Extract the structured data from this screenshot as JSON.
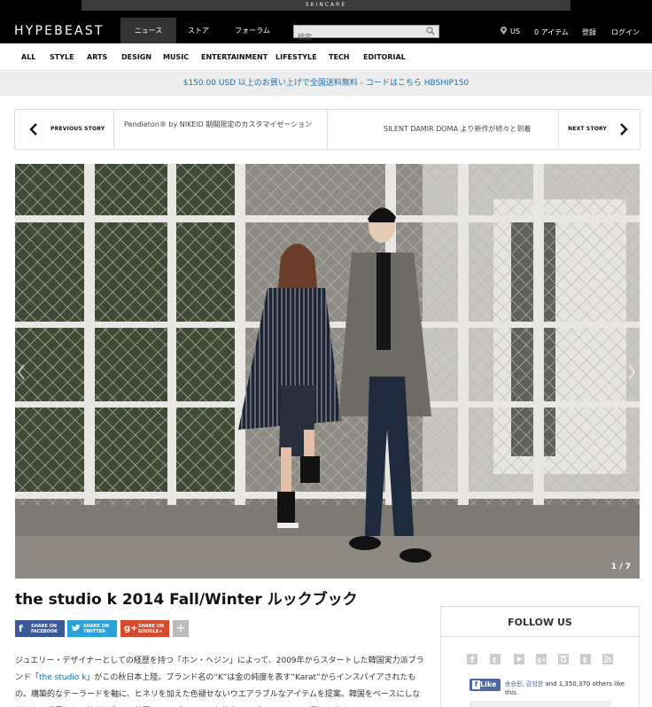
{
  "ad": {
    "text": "SKINCARE"
  },
  "header": {
    "logo": "HYPEBEAST",
    "tabs": [
      "ニュース",
      "ストア",
      "フォーラム"
    ],
    "search_placeholder": "検索",
    "region": "US",
    "cart": "0 アイテム",
    "register": "登録",
    "login": "ログイン"
  },
  "categories": [
    "ALL",
    "STYLE",
    "ARTS",
    "DESIGN",
    "MUSIC",
    "ENTERTAINMENT",
    "LIFESTYLE",
    "TECH",
    "EDITORIAL"
  ],
  "promo": "$150.00 USD 以上のお買い上げで全国送料無料 - コードはこちら HBSHIP150",
  "story_nav": {
    "prev_label": "PREVIOUS STORY",
    "prev_title": "Pendleton® by NIKEiD 期間限定のカスタマイゼーション",
    "next_title": "SILENT DAMIR DOMA より新作が続々と到着",
    "next_label": "NEXT STORY"
  },
  "gallery": {
    "counter": "1 / 7"
  },
  "article": {
    "title": "the studio k 2014 Fall/Winter ルックブック",
    "share": {
      "facebook": "SHARE ON FACEBOOK",
      "twitter": "SHARE ON TWITTER",
      "google": "SHARE ON GOOGLE+",
      "more": "+"
    },
    "body_1": "ジュエリー・デザイナーとしての経歴を持つ「ホン・ヘジン」によって、2009年からスタートした韓国実力派ブランド「",
    "body_link": "the studio k",
    "body_2": "」がこの秋日本上陸。ブランド名の“K”は金の純度を表す“Karat”からインスパイアされたもの。構築的なテーラードを軸に、ヒネリを加えた色褪せないウエアラブルなアイテムを提案。韓国をベースにしながらも、世界からの注目を集め、韓国のコンプラシーンを代表するブランドとして評価を高めてい"
  },
  "sidebar": {
    "follow_title": "FOLLOW US",
    "like_button": "Like",
    "like_names": "송승원, 김성찬",
    "like_count_text": " and 1,350,370 others like this."
  },
  "colors": {
    "facebook": "#3b5998",
    "twitter": "#2aa3d9",
    "google": "#d6492f",
    "link": "#1a6fa8"
  }
}
